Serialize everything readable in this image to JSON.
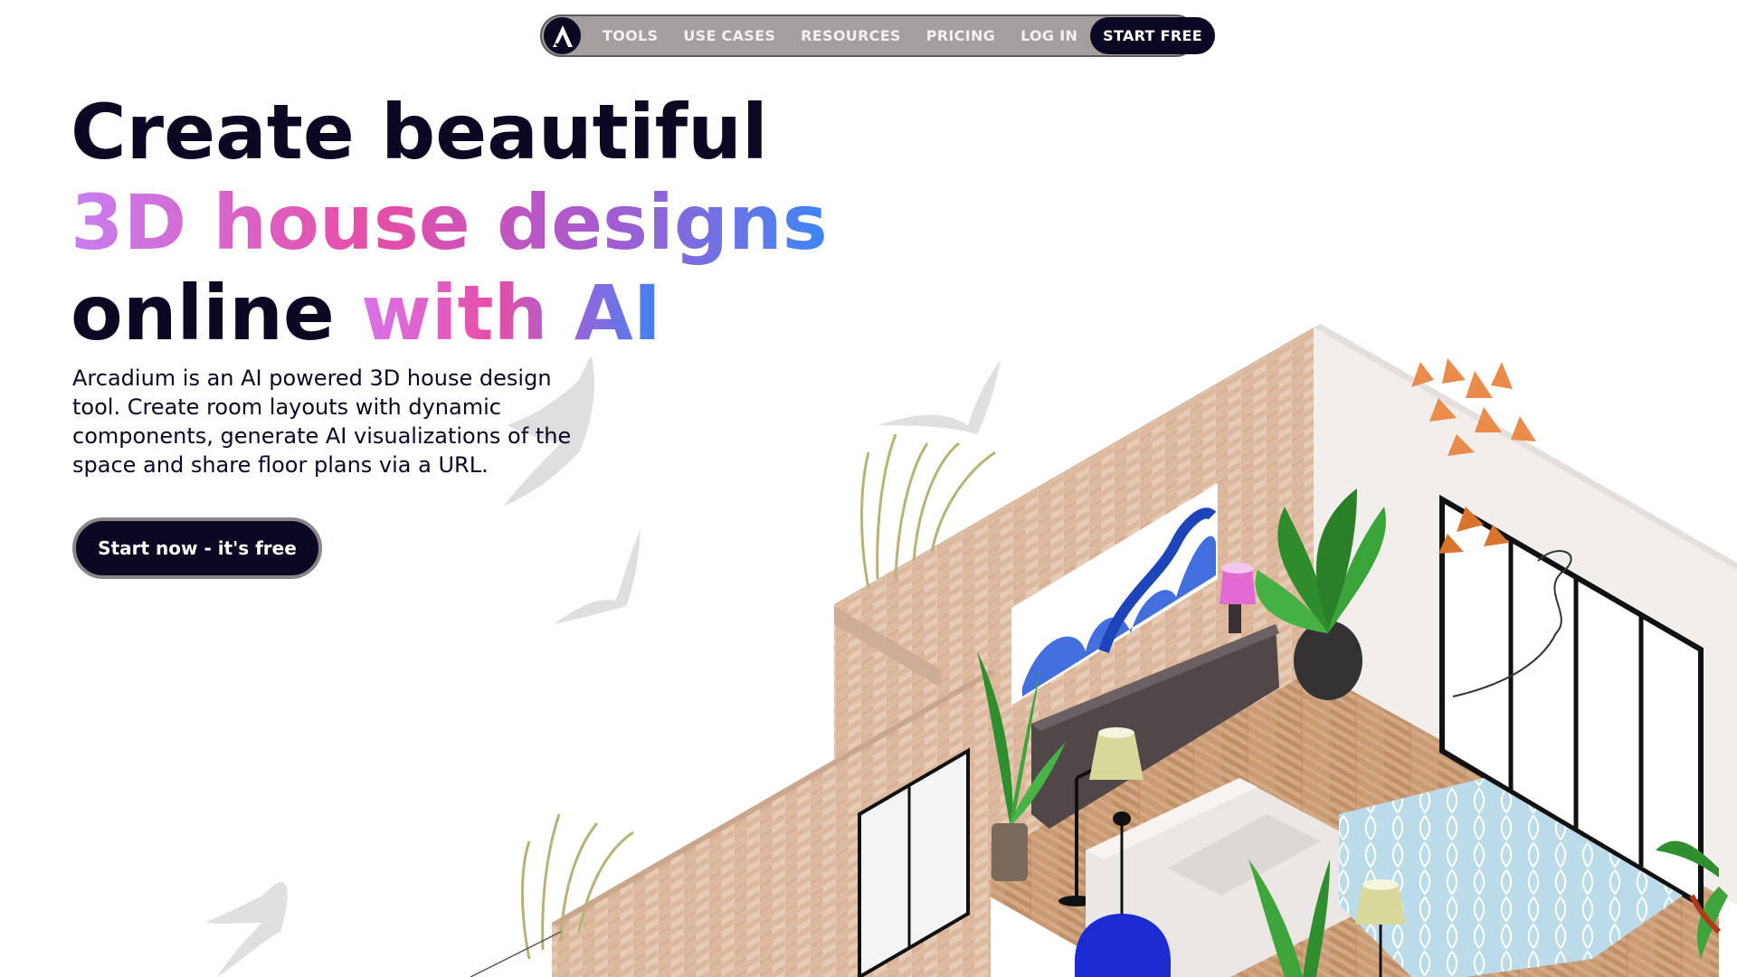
{
  "nav": {
    "logo_icon": "arcadium-logo-icon",
    "links": [
      "TOOLS",
      "USE CASES",
      "RESOURCES",
      "PRICING",
      "LOG IN"
    ],
    "cta_label": "START FREE"
  },
  "hero": {
    "title_line1": "Create beautiful",
    "title_line2": "3D house designs",
    "title_line3_plain": "online ",
    "title_line3_accent": "with AI",
    "description": "Arcadium is an AI powered 3D house design tool. Create room layouts with dynamic components, generate AI visualizations of the space and share floor plans via a URL.",
    "cta_label": "Start now - it's free"
  },
  "colors": {
    "navy": "#0a0822",
    "nav_bg": "#a49e9f",
    "gradient_start": "#c77ef0",
    "gradient_mid": "#e84da5",
    "gradient_end": "#3c86f5"
  },
  "illustration": {
    "name": "isometric-3d-living-room"
  }
}
